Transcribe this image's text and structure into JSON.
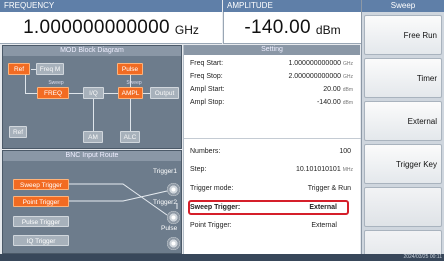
{
  "readout": {
    "frequency": {
      "label": "FREQUENCY",
      "value": "1.000000000000",
      "unit": "GHz"
    },
    "amplitude": {
      "label": "AMPLITUDE",
      "value": "-140.00",
      "unit": "dBm"
    }
  },
  "softkeys": {
    "title": "Sweep",
    "keys": [
      "Free Run",
      "Timer",
      "External",
      "Trigger Key",
      "",
      ""
    ]
  },
  "block_diagram": {
    "title": "MOD Block Diagram",
    "labels": {
      "ref": "Ref",
      "freq_mod": "Freq M",
      "pulse": "Pulse",
      "freq": "FREQ",
      "iq": "I/Q",
      "ampl": "AMPL",
      "output": "Output",
      "ref_bottom": "Ref",
      "am": "AM",
      "alc": "ALC",
      "sweep_small_1": "Sweep",
      "sweep_small_2": "Sweep"
    }
  },
  "bnc": {
    "title": "BNC Input Route",
    "buttons": [
      "Sweep Trigger",
      "Point Trigger",
      "Pulse Trigger",
      "IQ Trigger"
    ],
    "ports": [
      "Trigger1",
      "Trigger2",
      "Pulse"
    ]
  },
  "setting": {
    "title": "Setting",
    "rows": [
      {
        "key": "Freq Start:",
        "value": "1.000000000000",
        "unit": "GHz"
      },
      {
        "key": "Freq Stop:",
        "value": "2.000000000000",
        "unit": "GHz"
      },
      {
        "key": "Ampl Start:",
        "value": "20.00",
        "unit": "dBm"
      },
      {
        "key": "Ampl Stop:",
        "value": "-140.00",
        "unit": "dBm"
      },
      {
        "key": "Numbers:",
        "value": "100",
        "unit": ""
      },
      {
        "key": "Step:",
        "value": "10.101010101",
        "unit": "MHz"
      },
      {
        "key": "Trigger mode:",
        "value": "Trigger & Run",
        "unit": ""
      },
      {
        "key": "Sweep Trigger:",
        "value": "External",
        "unit": ""
      },
      {
        "key": "Point Trigger:",
        "value": "External",
        "unit": ""
      }
    ]
  },
  "status": {
    "timestamp": "2024/03/25 00:11"
  },
  "colors": {
    "accent": "#5f7fa8",
    "active_block": "#f26b22",
    "highlight": "#d51f2a"
  }
}
